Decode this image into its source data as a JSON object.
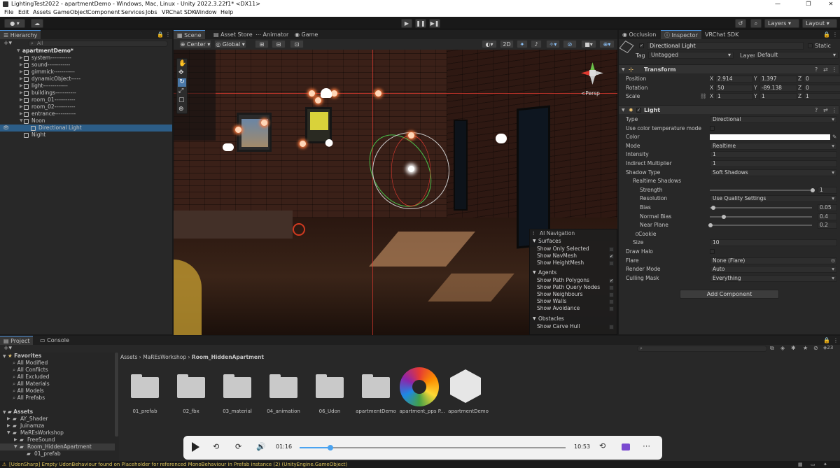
{
  "window": {
    "title": "LightingTest2022 - apartmentDemo - Windows, Mac, Linux - Unity 2022.3.22f1* <DX11>",
    "min": "—",
    "max": "❐",
    "close": "✕"
  },
  "menu": [
    "File",
    "Edit",
    "Assets",
    "GameObject",
    "Component",
    "Services",
    "Jobs",
    "VRChat SDK",
    "Window",
    "Help"
  ],
  "toolbar": {
    "layers": "Layers",
    "layout": "Layout",
    "play": "▶",
    "pause": "❚❚",
    "step": "▶❚"
  },
  "hierarchy": {
    "tab": "Hierarchy",
    "search": "All",
    "root": "apartmentDemo*",
    "items": [
      {
        "label": "system-----------",
        "depth": 1,
        "arrow": "▶"
      },
      {
        "label": "sound------------",
        "depth": 1,
        "arrow": "▶"
      },
      {
        "label": "gimmick-----------",
        "depth": 1,
        "arrow": "▶"
      },
      {
        "label": "dynamicObject-----",
        "depth": 1,
        "arrow": "▶"
      },
      {
        "label": "light-------------",
        "depth": 1,
        "arrow": "▶"
      },
      {
        "label": "buildings-----------",
        "depth": 1,
        "arrow": "▶"
      },
      {
        "label": "room_01-----------",
        "depth": 1,
        "arrow": "▶"
      },
      {
        "label": "room_02-----------",
        "depth": 1,
        "arrow": "▶"
      },
      {
        "label": "entrance-----------",
        "depth": 1,
        "arrow": "▶"
      },
      {
        "label": "Noon",
        "depth": 1,
        "arrow": "▼"
      },
      {
        "label": "Directional Light",
        "depth": 2,
        "arrow": ""
      },
      {
        "label": "Night",
        "depth": 1,
        "arrow": ""
      }
    ]
  },
  "sceneTabs": [
    "Scene",
    "Asset Store",
    "Animator",
    "Game"
  ],
  "sceneToolbar": {
    "pivot": "Center",
    "space": "Global",
    "mode2d": "2D"
  },
  "gizmo": {
    "persp": "<Persp"
  },
  "aiNav": {
    "title": "AI Navigation",
    "surfaces": "Surfaces",
    "surfaceItems": [
      {
        "label": "Show Only Selected",
        "on": false
      },
      {
        "label": "Show NavMesh",
        "on": true
      },
      {
        "label": "Show HeightMesh",
        "on": false
      }
    ],
    "agents": "Agents",
    "agentItems": [
      {
        "label": "Show Path Polygons",
        "on": true
      },
      {
        "label": "Show Path Query Nodes",
        "on": false
      },
      {
        "label": "Show Neighbours",
        "on": false
      },
      {
        "label": "Show Walls",
        "on": false
      },
      {
        "label": "Show Avoidance",
        "on": false
      }
    ],
    "obstacles": "Obstacles",
    "obstacleItems": [
      {
        "label": "Show Carve Hull",
        "on": false
      }
    ]
  },
  "inspector": {
    "tabs": [
      "Occlusion",
      "Inspector",
      "VRChat SDK"
    ],
    "name": "Directional Light",
    "static": "Static",
    "tagLabel": "Tag",
    "tag": "Untagged",
    "layerLabel": "Layer",
    "layer": "Default",
    "transform": {
      "title": "Transform",
      "position": {
        "label": "Position",
        "x": "2.914",
        "y": "1.397",
        "z": "0"
      },
      "rotation": {
        "label": "Rotation",
        "x": "50",
        "y": "-89.138",
        "z": "0"
      },
      "scale": {
        "label": "Scale",
        "x": "1",
        "y": "1",
        "z": "1"
      }
    },
    "light": {
      "title": "Light",
      "rows": [
        {
          "k": "Type",
          "v": "Directional",
          "dd": true
        },
        {
          "k": "Use color temperature mode",
          "v": "",
          "chk": true
        },
        {
          "k": "Color",
          "v": "",
          "color": true
        },
        {
          "k": "Mode",
          "v": "Realtime",
          "dd": true
        },
        {
          "k": "Intensity",
          "v": "1"
        },
        {
          "k": "Indirect Multiplier",
          "v": "1"
        },
        {
          "k": "Shadow Type",
          "v": "Soft Shadows",
          "dd": true
        },
        {
          "k": "Realtime Shadows",
          "v": "",
          "indent": 1
        },
        {
          "k": "Strength",
          "v": "1",
          "indent": 2,
          "slider": 1.0
        },
        {
          "k": "Resolution",
          "v": "Use Quality Settings",
          "indent": 2,
          "dd": true
        },
        {
          "k": "Bias",
          "v": "0.05",
          "indent": 2,
          "slider": 0.025
        },
        {
          "k": "Normal Bias",
          "v": "0.4",
          "indent": 2,
          "slider": 0.13
        },
        {
          "k": "Near Plane",
          "v": "0.2",
          "indent": 2,
          "slider": 0.0
        },
        {
          "k": "Cookie",
          "v": "",
          "indent": 1,
          "obj": true
        },
        {
          "k": "Size",
          "v": "10",
          "indent": 1
        },
        {
          "k": "Draw Halo",
          "v": "",
          "chk": true
        },
        {
          "k": "Flare",
          "v": "None (Flare)",
          "obj": true
        },
        {
          "k": "Render Mode",
          "v": "Auto",
          "dd": true
        },
        {
          "k": "Culling Mask",
          "v": "Everything",
          "dd": true
        }
      ]
    },
    "addComponent": "Add Component"
  },
  "project": {
    "tabs": [
      "Project",
      "Console"
    ],
    "favorites": "Favorites",
    "favItems": [
      "All Modified",
      "All Conflicts",
      "All Excluded",
      "All Materials",
      "All Models",
      "All Prefabs"
    ],
    "assets": "Assets",
    "assetItems": [
      {
        "label": "AY_Shader",
        "d": 1
      },
      {
        "label": "Juinamza",
        "d": 1
      },
      {
        "label": "MaREsWorkshop",
        "d": 1
      },
      {
        "label": "FreeSound",
        "d": 2
      },
      {
        "label": "Room_HiddenApartment",
        "d": 2
      },
      {
        "label": "01_prefab",
        "d": 3
      }
    ],
    "breadcrumb": [
      "Assets",
      "MaREsWorkshop",
      "Room_HiddenApartment"
    ],
    "items": [
      "01_prefab",
      "02_fbx",
      "03_material",
      "04_animation",
      "06_Udon",
      "apartmentDemo",
      "apartment_pps P...",
      "apartmentDemo"
    ],
    "count": "23"
  },
  "video": {
    "current": "01:16",
    "total": "10:53",
    "progress": 0.116
  },
  "status": {
    "text": "[UdonSharp] Empty UdonBehaviour found on Placeholder for referenced MonoBehaviour in Prefab instance (2) (UnityEngine.GameObject)"
  },
  "colors": {
    "accent": "#4a90d9",
    "selection": "#2c5d87",
    "video": "#4aa3f0"
  }
}
